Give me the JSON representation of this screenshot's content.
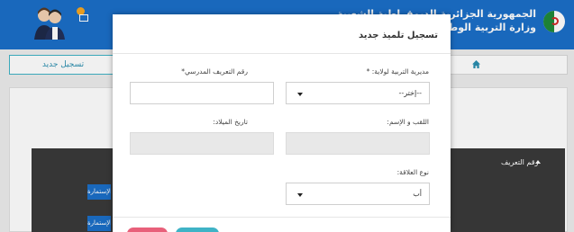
{
  "header": {
    "brand_line1": "الجمهورية الجزائرية الديمقراطية الشعبية",
    "brand_line2": "وزارة التربية الوطنية"
  },
  "toolbar": {
    "new_registration_label": "تسجيل جديد"
  },
  "table": {
    "column_header": "رقم التعريف",
    "row_button_label": "الإستمارة"
  },
  "modal": {
    "title": "تسجيل تلميذ جديد",
    "fields": {
      "directorate_label": "مديرية التربية لولاية: *",
      "directorate_value": "--إختر--",
      "school_id_label": "رقم التعريف المدرسي*",
      "name_label": "اللقب و الإسم:",
      "birthdate_label": "تاريخ الميلاد:",
      "sex_label": "نوع العلاقة:",
      "sex_value": "أب"
    }
  },
  "colors": {
    "primary": "#1b6fc8",
    "teal": "#3fb3c6",
    "danger": "#e8607a"
  }
}
